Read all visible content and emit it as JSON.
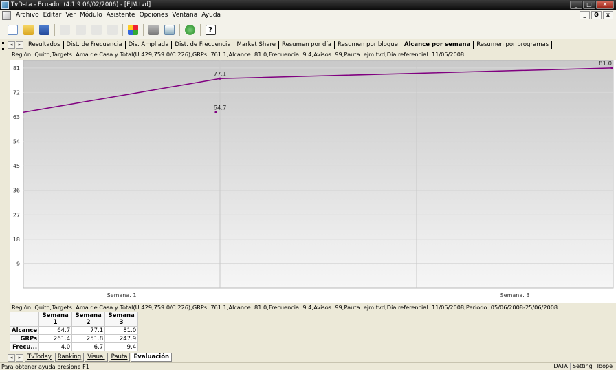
{
  "window": {
    "title": "TvData - Ecuador (4.1.9 06/02/2006) - [EJM.tvd]",
    "min": "_",
    "max": "□",
    "close": "✕"
  },
  "mdi": {
    "min": "_",
    "restore": "ʘ",
    "close": "x"
  },
  "menu": [
    "Archivo",
    "Editar",
    "Ver",
    "Módulo",
    "Asistente",
    "Opciones",
    "Ventana",
    "Ayuda"
  ],
  "toolbar": {
    "icons": [
      "new-document-icon",
      "open-folder-icon",
      "save-icon",
      "cut-icon",
      "copy-icon",
      "paste-icon",
      "find-icon",
      "module-icon",
      "print-icon",
      "print-preview-icon",
      "refresh-icon",
      "help-icon"
    ],
    "help_label": "?"
  },
  "tabs_top": [
    "Resultados",
    "Dist. de Frecuencia",
    "Dis. Ampliada",
    "Dist. de Frecuencia",
    "Market Share",
    "Resumen por día",
    "Resumen por bloque",
    "Alcance por semana",
    "Resumen por programas"
  ],
  "tabs_top_active": "Alcance por semana",
  "info_top": "Región: Quito;Targets: Ama de Casa y Total(U:429,759.0/C:226);GRPs: 761.1;Alcance: 81.0;Frecuencia: 9.4;Avisos: 99;Pauta: ejm.tvd;Día referencial: 11/05/2008",
  "info_bottom": "Región: Quito;Targets: Ama de Casa y Total(U:429,759.0/C:226);GRPs: 761.1;Alcance: 81.0;Frecuencia: 9.4;Avisos: 99;Pauta: ejm.tvd;Día referencial: 11/05/2008;Periodo: 05/06/2008-25/06/2008",
  "chart_data": {
    "type": "line",
    "categories": [
      "Semana. 1",
      "Semana. 2",
      "Semana. 3"
    ],
    "x_tick_labels_shown": [
      "Semana. 1",
      "Semana. 3"
    ],
    "series": [
      {
        "values": [
          64.7,
          77.1,
          81.0
        ],
        "color": "#800080"
      }
    ],
    "data_labels": [
      "64.7",
      "77.1",
      "81.0"
    ],
    "y_ticks": [
      9,
      18,
      27,
      36,
      45,
      54,
      63,
      72,
      81
    ],
    "ylim": [
      0,
      84
    ],
    "title": "",
    "xlabel": "",
    "ylabel": "",
    "grid": true,
    "legend": "none",
    "background": "gradient gray"
  },
  "table": {
    "headers": [
      "Semana 1",
      "Semana 2",
      "Semana 3"
    ],
    "rows": [
      {
        "label": "Alcance",
        "values": [
          "64.7",
          "77.1",
          "81.0"
        ]
      },
      {
        "label": "GRPs",
        "values": [
          "261.4",
          "251.8",
          "247.9"
        ]
      },
      {
        "label": "Frecu...",
        "values": [
          "4.0",
          "6.7",
          "9.4"
        ]
      }
    ]
  },
  "tabs_bottom": [
    "TvToday",
    "Ranking",
    "Visual",
    "Pauta",
    "Evaluación"
  ],
  "tabs_bottom_active": "Evaluación",
  "status": {
    "help_text": "Para obtener ayuda presione F1",
    "panels": [
      "DATA",
      "Setting",
      "Ibope"
    ]
  },
  "colors": {
    "series": "#800080",
    "titlebar": "#1a1a1a"
  }
}
